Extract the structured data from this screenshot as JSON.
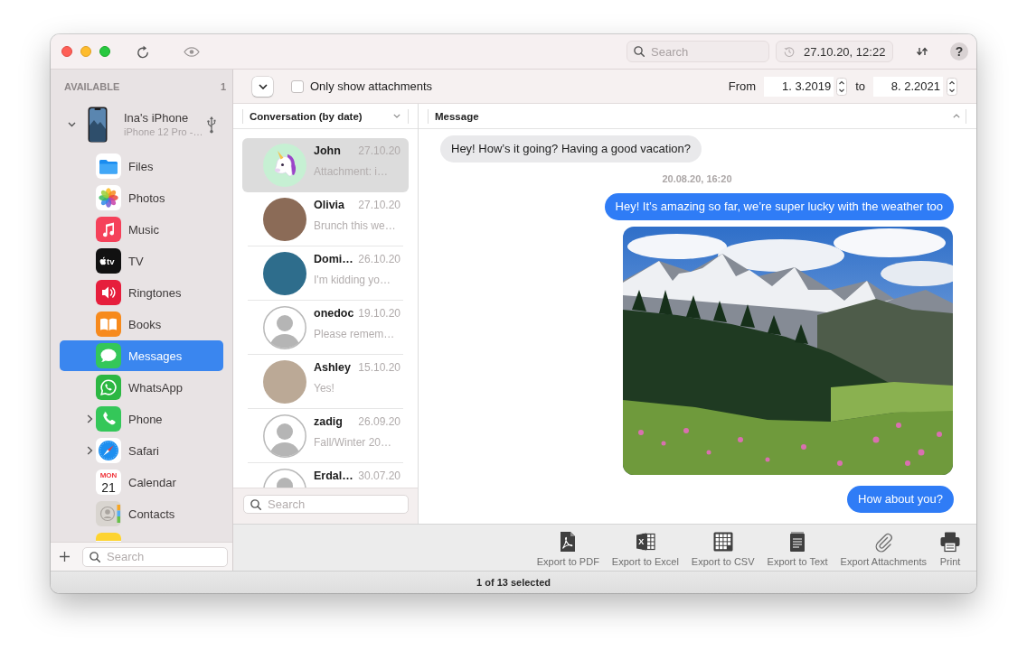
{
  "title_bar": {
    "search": {
      "placeholder": "Search"
    },
    "backup_date": "27.10.20, 12:22",
    "help": "?"
  },
  "sidebar": {
    "section": "AVAILABLE",
    "device_count": "1",
    "device": {
      "name": "Ina's iPhone",
      "model": "iPhone 12 Pro -…",
      "expanded": true
    },
    "items": [
      {
        "kind": "files",
        "label": "Files",
        "selected": false,
        "expandable": false
      },
      {
        "kind": "photos",
        "label": "Photos",
        "selected": false,
        "expandable": false
      },
      {
        "kind": "music",
        "label": "Music",
        "selected": false,
        "expandable": false
      },
      {
        "kind": "tv",
        "label": "TV",
        "icon_text": "tv",
        "selected": false,
        "expandable": false
      },
      {
        "kind": "ringtones",
        "label": "Ringtones",
        "selected": false,
        "expandable": false
      },
      {
        "kind": "books",
        "label": "Books",
        "selected": false,
        "expandable": false
      },
      {
        "kind": "messages",
        "label": "Messages",
        "selected": true,
        "expandable": false
      },
      {
        "kind": "whatsapp",
        "label": "WhatsApp",
        "selected": false,
        "expandable": false
      },
      {
        "kind": "phone",
        "label": "Phone",
        "selected": false,
        "expandable": true
      },
      {
        "kind": "safari",
        "label": "Safari",
        "selected": false,
        "expandable": true
      },
      {
        "kind": "calendar",
        "label": "Calendar",
        "icon_day": "MON",
        "icon_text": "21",
        "selected": false,
        "expandable": false
      },
      {
        "kind": "contacts",
        "label": "Contacts",
        "selected": false,
        "expandable": false
      },
      {
        "kind": "notes",
        "selected": false,
        "expandable": false
      }
    ],
    "search": {
      "placeholder": "Search"
    }
  },
  "filter_bar": {
    "attachments_only": {
      "label": "Only show attachments",
      "checked": false
    },
    "from_label": "From",
    "from_date": "1. 3.2019",
    "to_label": "to",
    "to_date": "8. 2.2021"
  },
  "conversations": {
    "header": "Conversation (by date)",
    "items": [
      {
        "kind": "emoji",
        "name": "John",
        "date": "27.10.20",
        "preview": "Attachment: i…",
        "selected": true
      },
      {
        "kind": "photo",
        "name": "Olivia",
        "date": "27.10.20",
        "preview": "Brunch this we…",
        "selected": false
      },
      {
        "kind": "photo",
        "name": "Domi…",
        "date": "26.10.20",
        "preview": "I'm kidding yo…",
        "selected": false
      },
      {
        "kind": "generic",
        "name": "onedoc",
        "date": "19.10.20",
        "preview": "Please remem…",
        "selected": false
      },
      {
        "kind": "photo",
        "name": "Ashley",
        "date": "15.10.20",
        "preview": "Yes!",
        "selected": false
      },
      {
        "kind": "generic",
        "name": "zadig",
        "date": "26.09.20",
        "preview": "Fall/Winter 20…",
        "selected": false
      },
      {
        "kind": "generic",
        "name": "Erdal…",
        "date": "30.07.20",
        "selected": false
      }
    ],
    "search": {
      "placeholder": "Search"
    }
  },
  "message_pane": {
    "header": "Message",
    "messages": [
      {
        "kind": "received",
        "text": "Hey! How’s it going? Having a good vacation?"
      },
      {
        "kind": "timestamp",
        "text": "20.08.20, 16:20"
      },
      {
        "kind": "sent",
        "text": "Hey! It’s amazing so far, we’re super lucky with the weather too"
      },
      {
        "kind": "photo"
      },
      {
        "kind": "sent",
        "text": "How about you?"
      }
    ]
  },
  "toolbar": {
    "actions": [
      {
        "kind": "pdf",
        "label": "Export to PDF"
      },
      {
        "kind": "excel",
        "label": "Export to Excel",
        "icon_text": "X"
      },
      {
        "kind": "csv",
        "label": "Export to CSV"
      },
      {
        "kind": "text",
        "label": "Export to Text"
      },
      {
        "kind": "attachments",
        "label": "Export Attachments"
      },
      {
        "kind": "print",
        "label": "Print"
      }
    ]
  },
  "status_bar": {
    "text": "1 of 13 selected"
  }
}
